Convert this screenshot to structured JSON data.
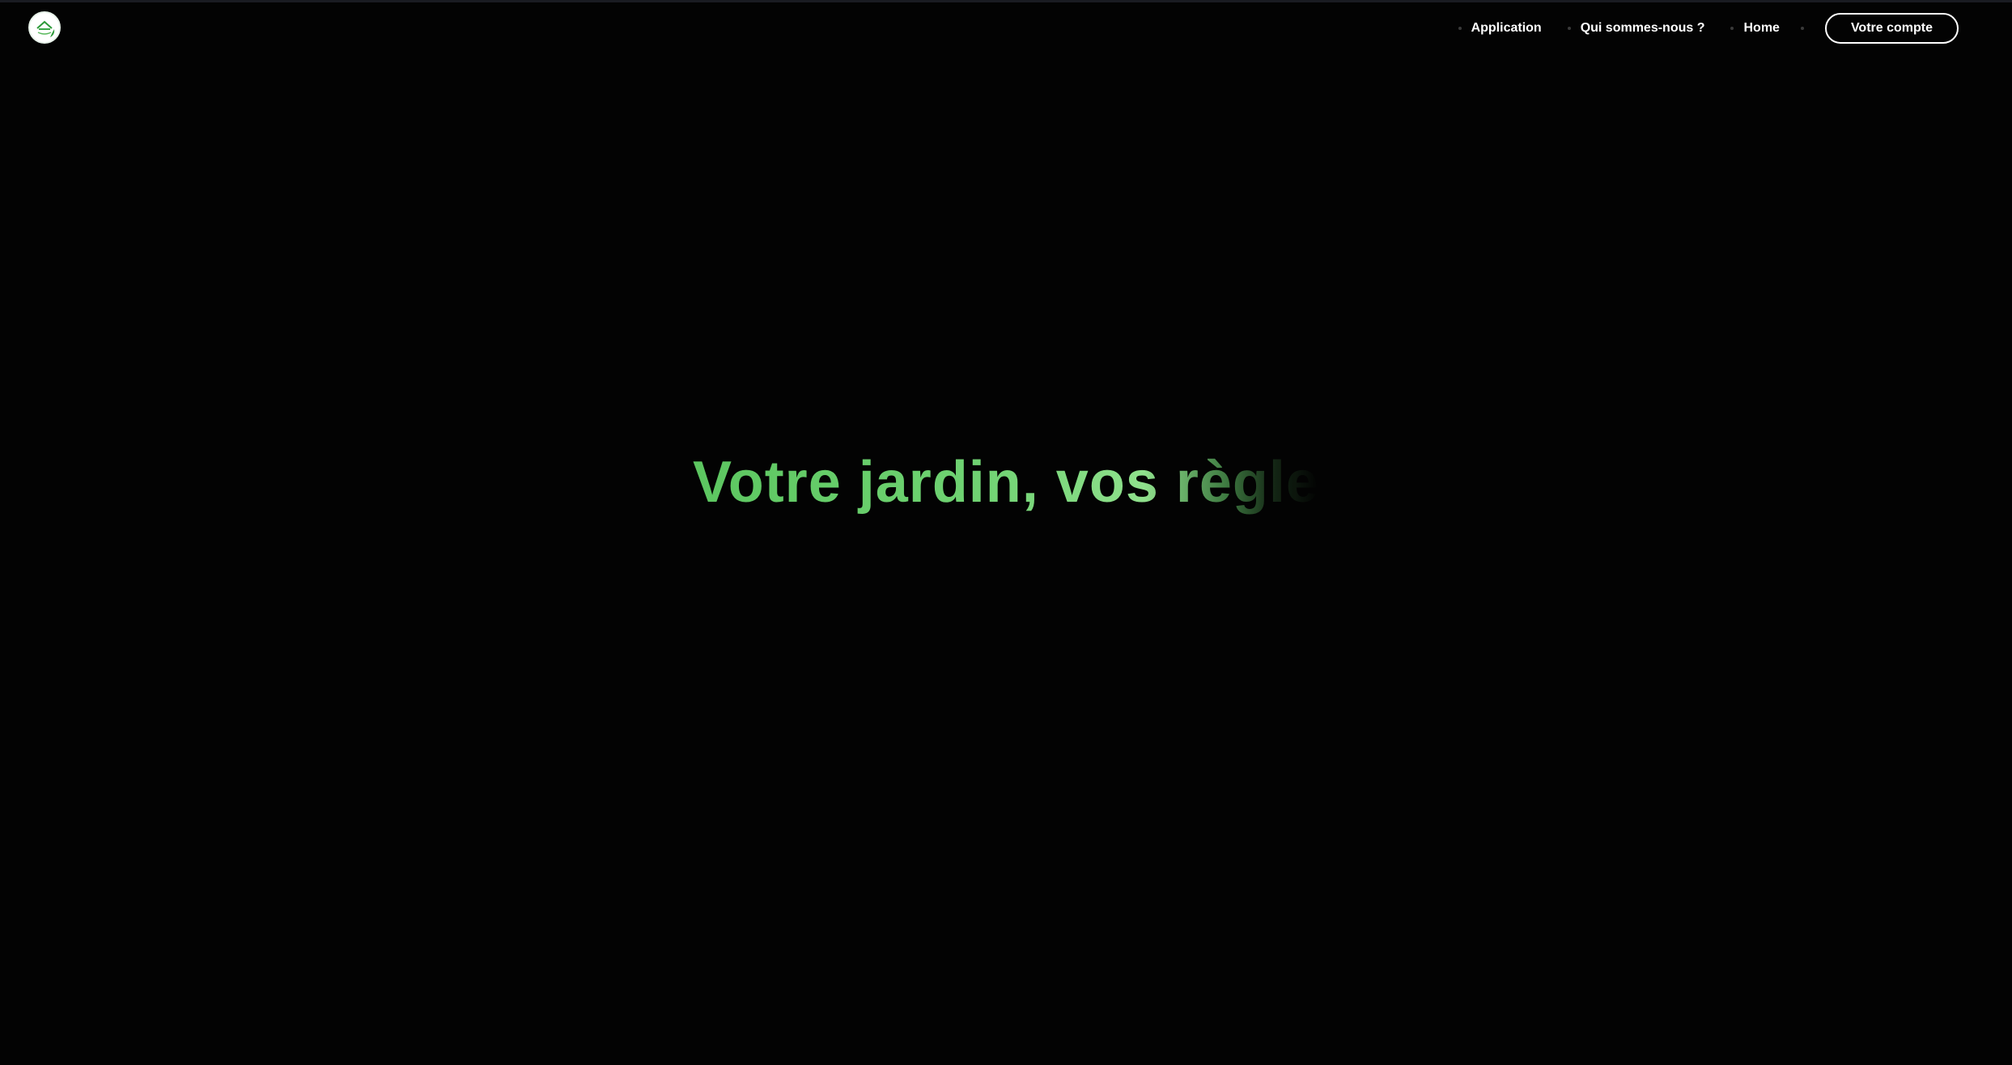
{
  "nav": {
    "items": [
      {
        "label": "Application"
      },
      {
        "label": "Qui sommes-nous ?"
      },
      {
        "label": "Home"
      }
    ],
    "account_button": "Votre compte"
  },
  "hero": {
    "title": "Votre jardin, vos règle"
  },
  "colors": {
    "background": "#030303",
    "accent_green": "#6fd272",
    "nav_text": "#ffffff"
  },
  "icons": {
    "logo": "garden-logo-icon"
  }
}
